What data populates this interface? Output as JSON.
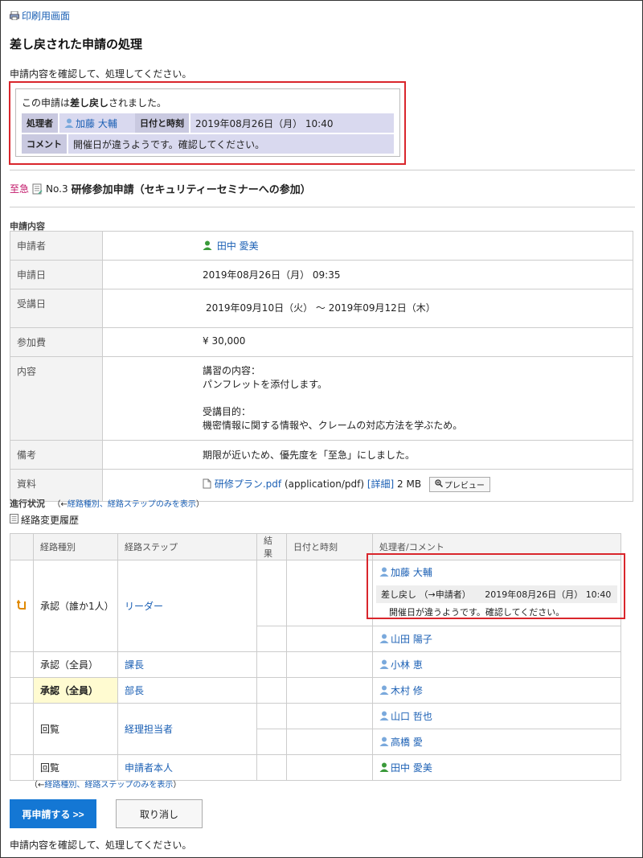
{
  "print_link": "印刷用画面",
  "page_title": "差し戻された申請の処理",
  "instruction": "申請内容を確認して、処理してください。",
  "returned": {
    "message_pre": "この申請は",
    "message_bold": "差し戻し",
    "message_post": "されました。",
    "processor_label": "処理者",
    "processor_name": "加藤 大輔",
    "datetime_label": "日付と時刻",
    "datetime_value": "2019年08月26日（月） 10:40",
    "comment_label": "コメント",
    "comment_value": "開催日が違うようです。確認してください。"
  },
  "subject": {
    "urgent": "至急",
    "number": "No.3",
    "title": "研修参加申請（セキュリティーセミナーへの参加）"
  },
  "detail_section_label": "申請内容",
  "detail": {
    "applicant_label": "申請者",
    "applicant_value": "田中 愛美",
    "applied_date_label": "申請日",
    "applied_date_value": "2019年08月26日（月） 09:35",
    "attend_date_label": "受講日",
    "attend_date_value": "2019年09月10日（火） 〜 2019年09月12日（木）",
    "fee_label": "参加費",
    "fee_value": "¥ 30,000",
    "content_label": "内容",
    "content_line1": "講習の内容：",
    "content_line2": "パンフレットを添付します。",
    "content_line3": "受講目的：",
    "content_line4": "機密情報に関する情報や、クレームの対応方法を学ぶため。",
    "remarks_label": "備考",
    "remarks_value": "期限が近いため、優先度を「至急」にしました。",
    "file_label": "資料",
    "file_name": "研修プラン.pdf",
    "file_type": "(application/pdf)",
    "file_detail": "[詳細]",
    "file_size": "2 MB",
    "preview_label": "プレビュー"
  },
  "progress": {
    "label": "進行状況",
    "toggle_prefix": "（←",
    "toggle_link": "経路種別、経路ステップのみを表示",
    "toggle_suffix": "）",
    "history_link": "経路変更履歴"
  },
  "route_table": {
    "headers": [
      "経路種別",
      "経路ステップ",
      "結果",
      "日付と時刻",
      "処理者/コメント"
    ],
    "rows": [
      {
        "type": "承認（誰か1人）",
        "step": "リーダー",
        "users": [
          "加藤 大輔",
          "山田 陽子"
        ]
      },
      {
        "type": "承認（全員）",
        "step": "課長",
        "users": [
          "小林 恵"
        ]
      },
      {
        "type": "承認（全員）",
        "step": "部長",
        "users": [
          "木村 修"
        ]
      },
      {
        "type": "回覧",
        "step": "経理担当者",
        "users": [
          "山口 哲也",
          "高橋 愛"
        ]
      },
      {
        "type": "回覧",
        "step": "申請者本人",
        "users": [
          "田中 愛美"
        ]
      }
    ],
    "comment_action": "差し戻し （→申請者）",
    "comment_datetime": "2019年08月26日（月） 10:40",
    "comment_text": "開催日が違うようです。確認してください。"
  },
  "buttons": {
    "resubmit": "再申請する >>",
    "cancel": "取り消し"
  },
  "colors": {
    "link": "#1a5fb4",
    "highlight_red": "#d9262c",
    "urgent": "#c2186a",
    "primary_button": "#1477d4",
    "current_step": "#fffbd1"
  }
}
